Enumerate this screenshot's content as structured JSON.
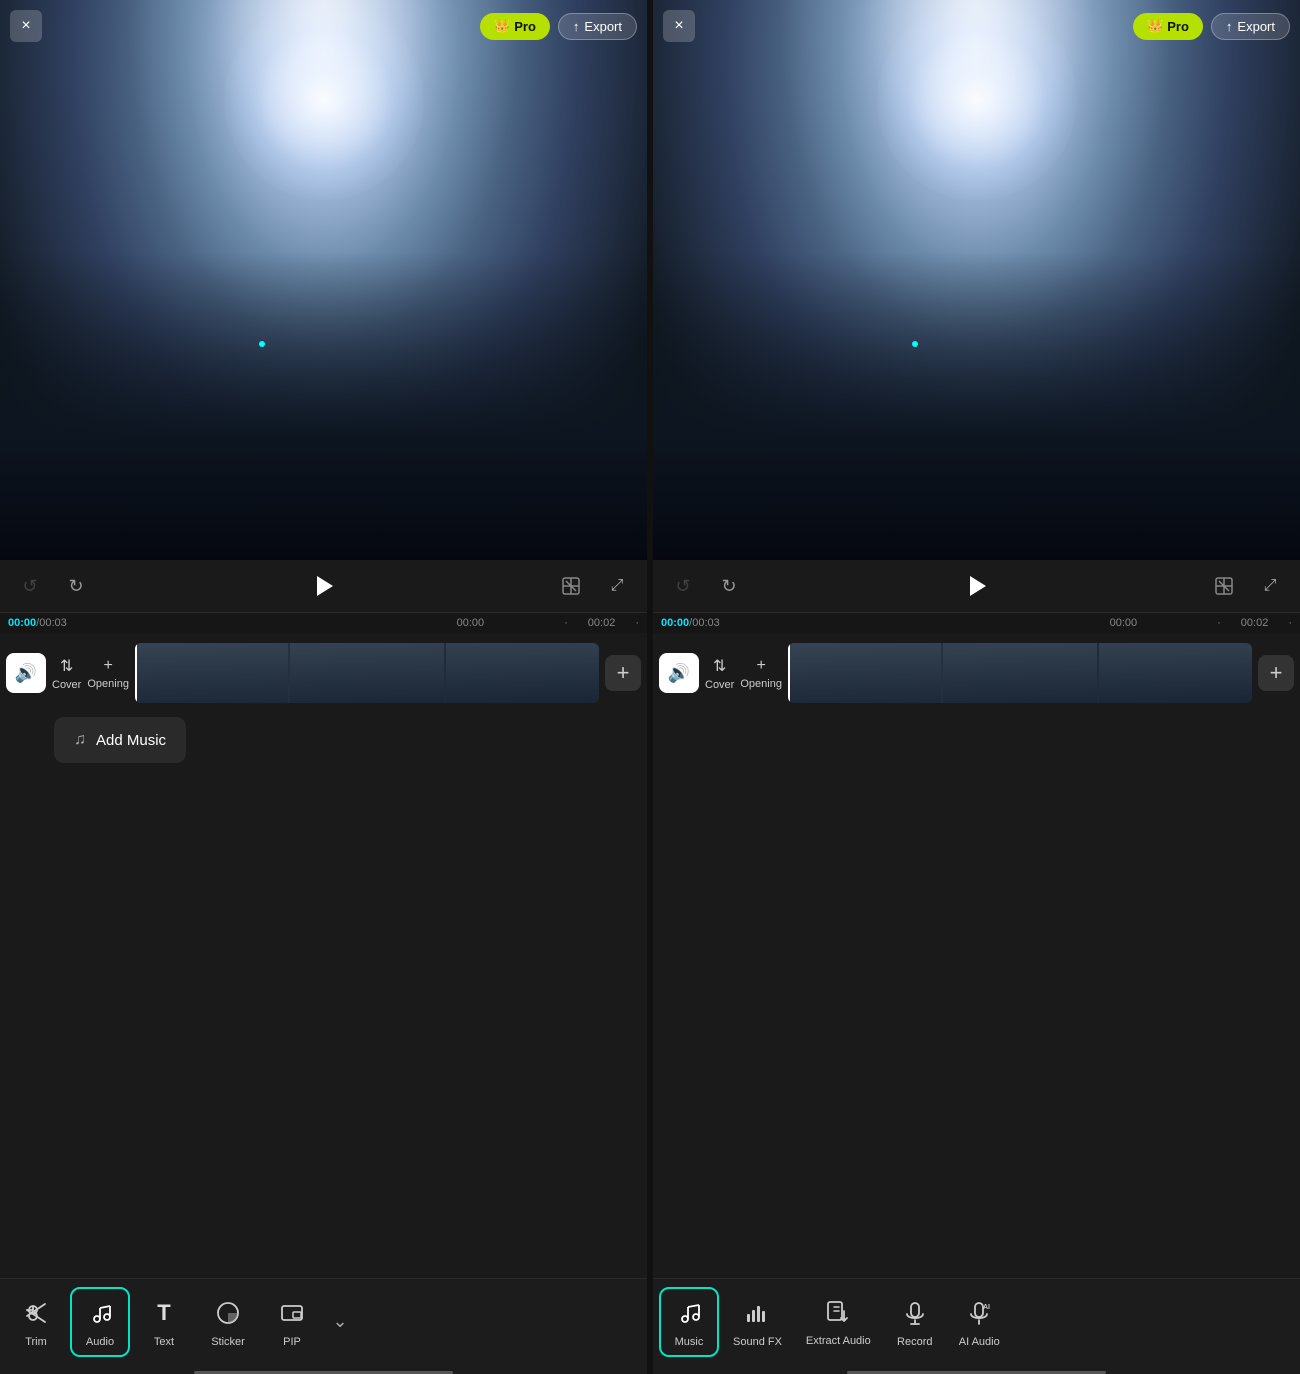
{
  "panels": [
    {
      "id": "left",
      "header": {
        "close_label": "×",
        "pro_label": "Pro",
        "export_label": "Export"
      },
      "controls": {
        "undo_label": "undo",
        "redo_label": "redo",
        "play_label": "play",
        "trim_label": "trim",
        "fullscreen_label": "fullscreen"
      },
      "timeline": {
        "current_time": "00:00",
        "total_time": "00:03",
        "markers": [
          "00:00",
          "00:02"
        ],
        "cover_label": "Cover",
        "opening_label": "Opening",
        "add_music_label": "Add Music"
      },
      "toolbar": {
        "items": [
          {
            "id": "trim",
            "label": "Trim",
            "icon": "scissors"
          },
          {
            "id": "audio",
            "label": "Audio",
            "icon": "music-note",
            "active": true
          },
          {
            "id": "text",
            "label": "Text",
            "icon": "T"
          },
          {
            "id": "sticker",
            "label": "Sticker",
            "icon": "sticker"
          },
          {
            "id": "pip",
            "label": "PIP",
            "icon": "pip"
          }
        ],
        "more_label": "more"
      }
    },
    {
      "id": "right",
      "header": {
        "close_label": "×",
        "pro_label": "Pro",
        "export_label": "Export"
      },
      "controls": {
        "undo_label": "undo",
        "redo_label": "redo",
        "play_label": "play",
        "trim_label": "trim",
        "fullscreen_label": "fullscreen"
      },
      "timeline": {
        "current_time": "00:00",
        "total_time": "00:03",
        "markers": [
          "00:00",
          "00:02"
        ],
        "cover_label": "Cover",
        "opening_label": "Opening"
      },
      "audio_submenu": {
        "items": [
          {
            "id": "music",
            "label": "Music",
            "icon": "music",
            "active": true
          },
          {
            "id": "sound-fx",
            "label": "Sound FX",
            "icon": "bars"
          },
          {
            "id": "extract-audio",
            "label": "Extract Audio",
            "icon": "extract"
          },
          {
            "id": "record",
            "label": "Record",
            "icon": "mic"
          },
          {
            "id": "ai-audio",
            "label": "AI Audio",
            "icon": "ai"
          }
        ]
      }
    }
  ],
  "colors": {
    "accent": "#00e5c8",
    "pro_bg": "#b5e000",
    "timeline_cursor": "#ffffff",
    "active_time": "#00e5ff"
  }
}
